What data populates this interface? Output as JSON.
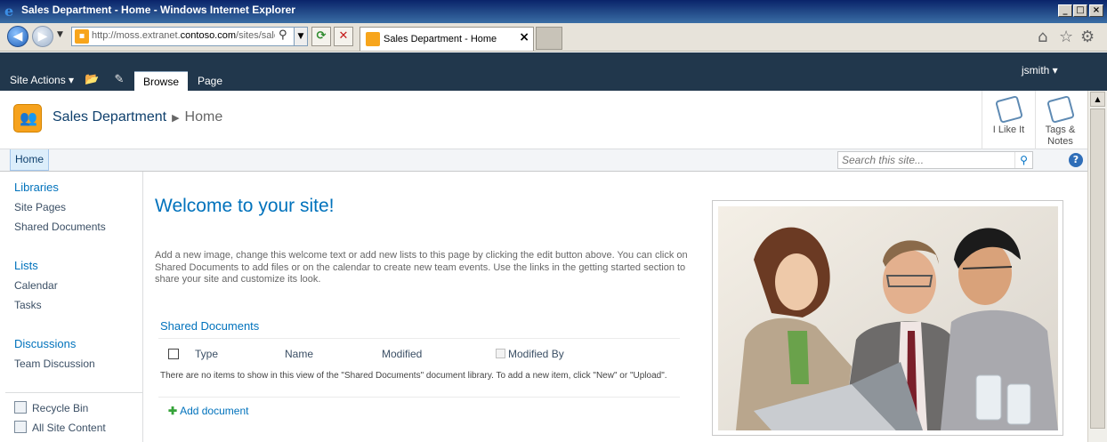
{
  "window": {
    "title": "Sales Department - Home - Windows Internet Explorer",
    "minimize": "_",
    "maximize": "□",
    "close": "×"
  },
  "browser": {
    "url_prefix": "http://moss.extranet.",
    "url_domain": "contoso.com",
    "url_suffix": "/sites/sales",
    "tab_title": "Sales Department - Home",
    "tab_close": "×",
    "icons": [
      "back-icon",
      "forward-icon",
      "refresh-icon",
      "stop-icon",
      "home-icon",
      "favorites-icon",
      "tools-icon"
    ]
  },
  "ribbon": {
    "site_actions": "Site Actions",
    "tabs": [
      {
        "label": "Browse",
        "active": true
      },
      {
        "label": "Page",
        "active": false
      }
    ],
    "user": "jsmith"
  },
  "site": {
    "title": "Sales Department",
    "current_page": "Home",
    "social": [
      {
        "label": "I Like It"
      },
      {
        "label": "Tags & Notes"
      }
    ]
  },
  "topnav": {
    "home": "Home",
    "search_placeholder": "Search this site...",
    "help": "?"
  },
  "leftnav": {
    "sections": [
      {
        "heading": "Libraries",
        "items": [
          "Site Pages",
          "Shared Documents"
        ]
      },
      {
        "heading": "Lists",
        "items": [
          "Calendar",
          "Tasks"
        ]
      },
      {
        "heading": "Discussions",
        "items": [
          "Team Discussion"
        ]
      }
    ],
    "footer": [
      "Recycle Bin",
      "All Site Content"
    ]
  },
  "main": {
    "welcome": "Welcome to your site!",
    "intro": "Add a new image, change this welcome text or add new lists to this page by clicking the edit button above. You can click on Shared Documents to add files or on the calendar to create new team events. Use the links in the getting started section to share your site and customize its look.",
    "webpart": {
      "title": "Shared Documents",
      "columns": [
        "Type",
        "Name",
        "Modified",
        "Modified By"
      ],
      "empty_message": "There are no items to show in this view of the \"Shared Documents\" document library. To add a new item, click \"New\" or \"Upload\".",
      "add_link": "Add document"
    }
  },
  "colors": {
    "ribbon_bg": "#21374c",
    "link_blue": "#0072bc",
    "title_bar": "#0a246a",
    "logo_orange": "#f6a21d"
  }
}
